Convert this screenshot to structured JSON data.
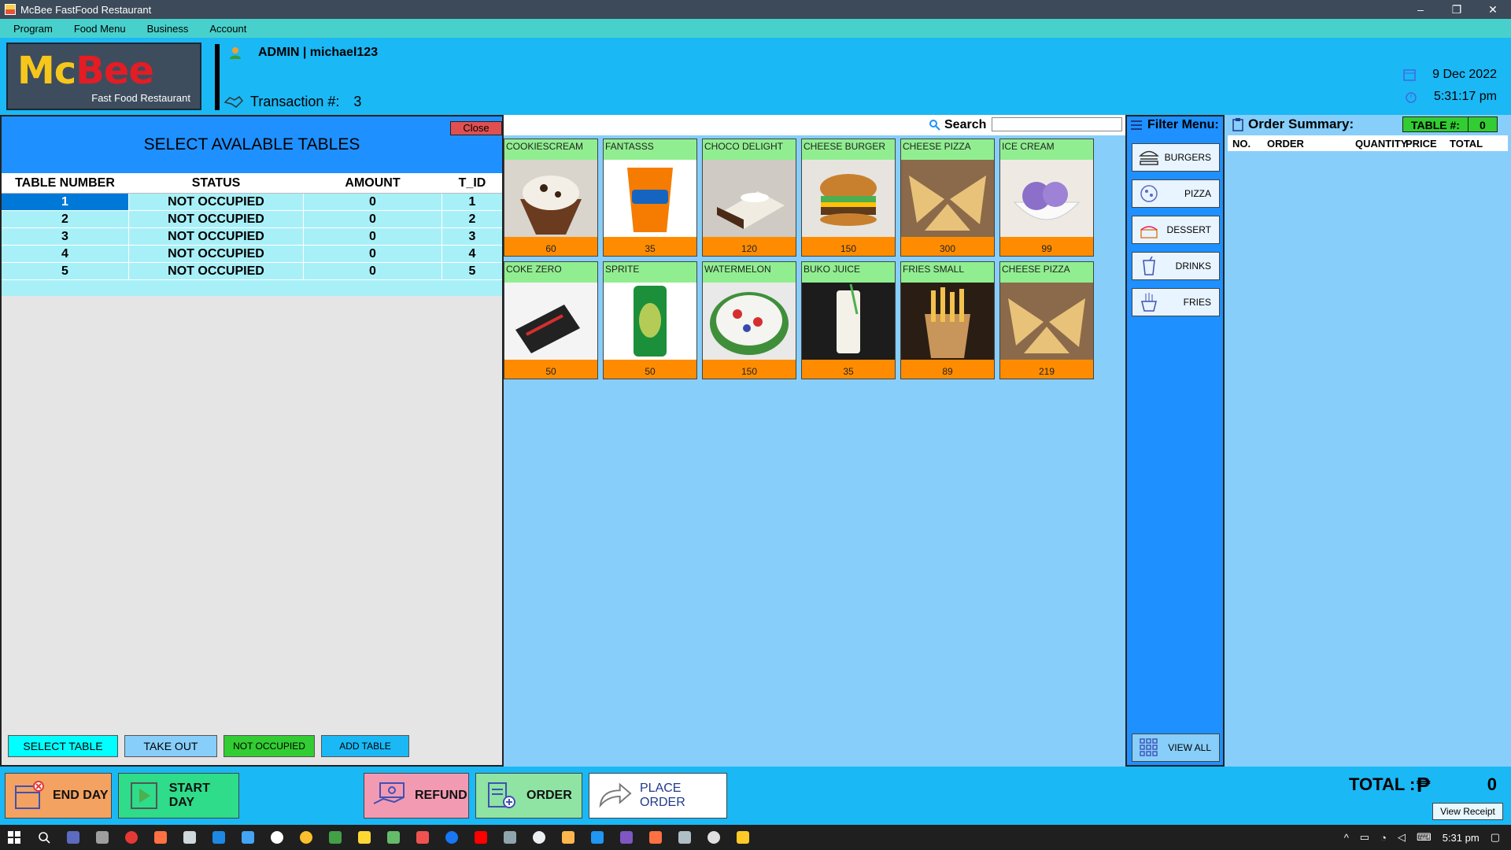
{
  "window": {
    "title": "McBee FastFood Restaurant",
    "min": "–",
    "max": "❐",
    "close": "✕"
  },
  "menubar": [
    "Program",
    "Food Menu",
    "Business",
    "Account"
  ],
  "header": {
    "brand_part1": "Mc",
    "brand_part2": "Bee",
    "brand_sub": "Fast Food Restaurant",
    "user": "ADMIN | michael123",
    "transaction_label": "Transaction #:",
    "transaction_no": "3",
    "date": "9 Dec 2022",
    "time": "5:31:17 pm"
  },
  "tables_panel": {
    "title": "SELECT AVALABLE TABLES",
    "close": "Close",
    "columns": [
      "TABLE NUMBER",
      "STATUS",
      "AMOUNT",
      "T_ID"
    ],
    "rows": [
      [
        "1",
        "NOT OCCUPIED",
        "0",
        "1"
      ],
      [
        "2",
        "NOT OCCUPIED",
        "0",
        "2"
      ],
      [
        "3",
        "NOT OCCUPIED",
        "0",
        "3"
      ],
      [
        "4",
        "NOT OCCUPIED",
        "0",
        "4"
      ],
      [
        "5",
        "NOT OCCUPIED",
        "0",
        "5"
      ]
    ],
    "buttons": [
      "SELECT TABLE",
      "TAKE OUT",
      "NOT OCCUPIED",
      "ADD TABLE"
    ]
  },
  "search": {
    "label": "Search",
    "value": ""
  },
  "menu_items": [
    {
      "name": "COOKIESCREAM",
      "price": "60"
    },
    {
      "name": "FANTASSS",
      "price": "35"
    },
    {
      "name": "CHOCO DELIGHT",
      "price": "120"
    },
    {
      "name": "CHEESE BURGER",
      "price": "150"
    },
    {
      "name": "CHEESE PIZZA",
      "price": "300"
    },
    {
      "name": "ICE CREAM",
      "price": "99"
    },
    {
      "name": "COKE ZERO",
      "price": "50"
    },
    {
      "name": "SPRITE",
      "price": "50"
    },
    {
      "name": "WATERMELON",
      "price": "150"
    },
    {
      "name": "BUKO JUICE",
      "price": "35"
    },
    {
      "name": "FRIES SMALL",
      "price": "89"
    },
    {
      "name": "CHEESE PIZZA",
      "price": "219"
    }
  ],
  "filter": {
    "title": "Filter Menu:",
    "buttons": [
      "BURGERS",
      "PIZZA",
      "DESSERT",
      "DRINKS",
      "FRIES"
    ],
    "view_all": "VIEW ALL"
  },
  "order_summary": {
    "title": "Order Summary:",
    "table_label": "TABLE #:",
    "table_no": "0",
    "columns": [
      "NO.",
      "ORDER",
      "QUANTITY",
      "PRICE",
      "TOTAL"
    ]
  },
  "bottom": {
    "end_day": "END DAY",
    "start_day": "START DAY",
    "refund": "REFUND",
    "order": "ORDER",
    "place_order": "PLACE ORDER",
    "total_label": "TOTAL :",
    "currency": "₱",
    "total_value": "0",
    "view_receipt": "View Receipt"
  },
  "taskbar": {
    "time": "5:31 pm"
  }
}
